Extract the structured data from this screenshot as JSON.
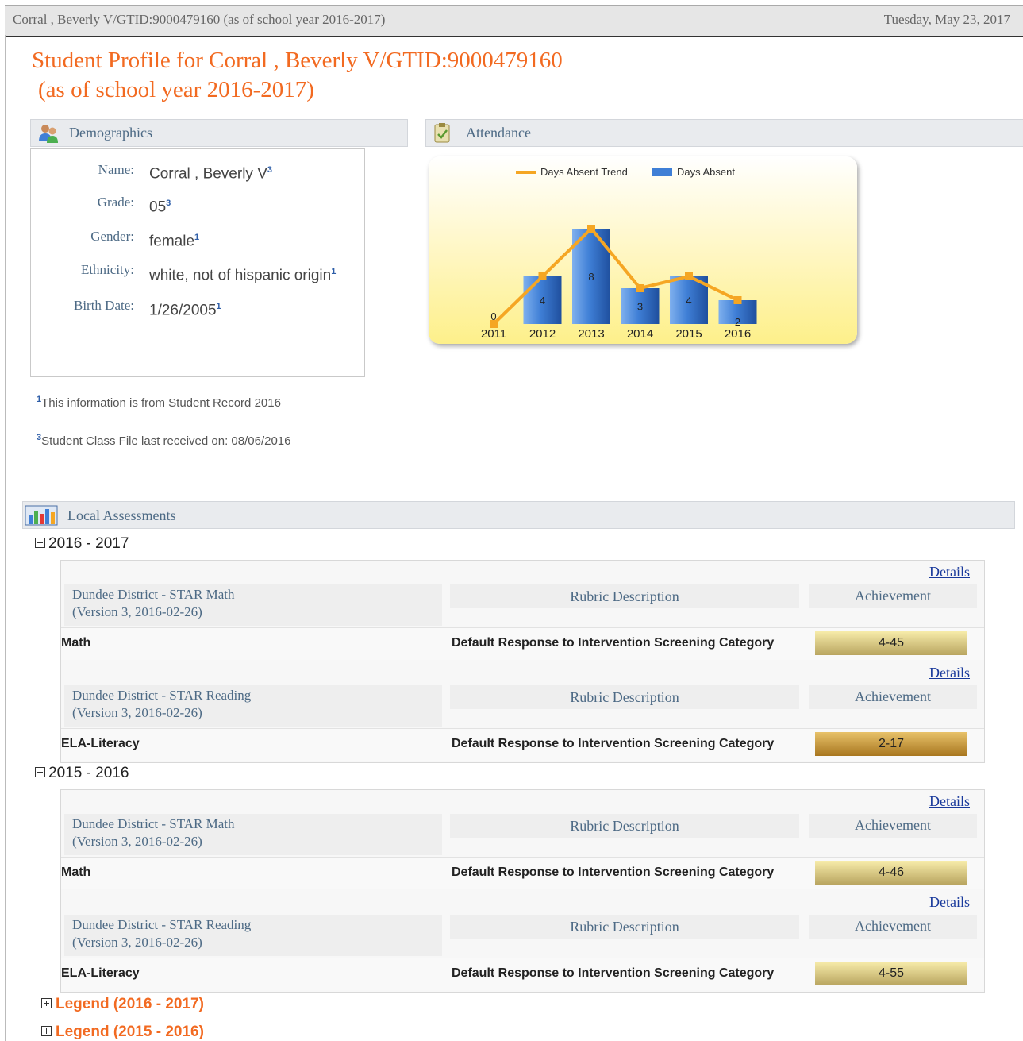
{
  "topbar": {
    "left_text": "Corral , Beverly V/GTID:9000479160 (as of school year 2016-2017)",
    "right_text": "Tuesday, May 23, 2017"
  },
  "page_title": {
    "line1": "Student Profile for Corral , Beverly V/GTID:9000479160",
    "line2": "(as of school year 2016-2017)"
  },
  "demographics": {
    "header": "Demographics",
    "icon": "people-icon",
    "fields": [
      {
        "label": "Name:",
        "value": "Corral , Beverly V",
        "sup": "3"
      },
      {
        "label": "Grade:",
        "value": "05",
        "sup": "3"
      },
      {
        "label": "Gender:",
        "value": "female",
        "sup": "1"
      },
      {
        "label": "Ethnicity:",
        "value": "white, not of hispanic origin",
        "sup": "1"
      },
      {
        "label": "Birth Date:",
        "value": "1/26/2005",
        "sup": "1"
      }
    ],
    "footnotes": [
      {
        "sup": "1",
        "text": "This information is from Student Record 2016"
      },
      {
        "sup": "3",
        "text": "Student Class File last received on: 08/06/2016"
      }
    ]
  },
  "attendance": {
    "header": "Attendance",
    "icon": "clipboard-icon"
  },
  "chart_data": {
    "type": "bar",
    "categories": [
      "2011",
      "2012",
      "2013",
      "2014",
      "2015",
      "2016"
    ],
    "series": [
      {
        "name": "Days Absent",
        "type": "bar",
        "values": [
          0,
          4,
          8,
          3,
          4,
          2
        ],
        "color": "#3f7fd6"
      },
      {
        "name": "Days Absent Trend",
        "type": "line",
        "values": [
          0,
          4,
          8,
          3,
          4,
          2
        ],
        "color": "#f5a623"
      }
    ],
    "data_labels": [
      "0",
      "4",
      "8",
      "3",
      "4",
      "2"
    ],
    "ylim": [
      0,
      8
    ],
    "legend_position": "top"
  },
  "local_assessments": {
    "header": "Local Assessments",
    "icon": "bar-chart-icon",
    "years": [
      {
        "year": "2016 - 2017",
        "groups": [
          {
            "details": "Details",
            "test_line1": "Dundee District - STAR Math",
            "test_line2": "(Version 3, 2016-02-26)",
            "rubric_header": "Rubric Description",
            "achievement_header": "Achievement",
            "subject": "Math",
            "rubric": "Default Response to Intervention Screening Category",
            "achievement": "4-45"
          },
          {
            "details": "Details",
            "test_line1": "Dundee District - STAR Reading",
            "test_line2": "(Version 3, 2016-02-26)",
            "rubric_header": "Rubric Description",
            "achievement_header": "Achievement",
            "subject": "ELA-Literacy",
            "rubric": "Default Response to Intervention Screening Category",
            "achievement": "2-17"
          }
        ]
      },
      {
        "year": "2015 - 2016",
        "groups": [
          {
            "details": "Details",
            "test_line1": "Dundee District - STAR Math",
            "test_line2": "(Version 3, 2016-02-26)",
            "rubric_header": "Rubric Description",
            "achievement_header": "Achievement",
            "subject": "Math",
            "rubric": "Default Response to Intervention Screening Category",
            "achievement": "4-46"
          },
          {
            "details": "Details",
            "test_line1": "Dundee District - STAR Reading",
            "test_line2": "(Version 3, 2016-02-26)",
            "rubric_header": "Rubric Description",
            "achievement_header": "Achievement",
            "subject": "ELA-Literacy",
            "rubric": "Default Response to Intervention Screening Category",
            "achievement": "4-55"
          }
        ]
      }
    ],
    "legends": [
      "Legend (2016 - 2017)",
      "Legend (2015 - 2016)"
    ]
  },
  "colors": {
    "title": "#f26a21",
    "achievement_light": "#f2e6a0",
    "achievement_dark": "#c79a3a"
  }
}
